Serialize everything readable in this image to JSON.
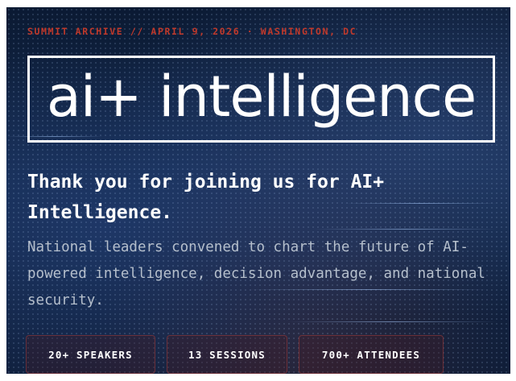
{
  "hero": {
    "tagline": "SUMMIT ARCHIVE // APRIL 9, 2026 · WASHINGTON, DC",
    "logo": "ai+ intelligence",
    "headline": "Thank you for joining us for AI+ Intelligence.",
    "subtext": "National leaders convened to chart the future of AI-powered intelligence, decision advantage, and national security.",
    "stats": [
      "20+ SPEAKERS",
      "13 SESSIONS",
      "700+ ATTENDEES"
    ]
  },
  "colors": {
    "accent": "#c0392b",
    "background": "#13284a",
    "text": "#ffffff",
    "subtext": "#b5bfcc"
  }
}
